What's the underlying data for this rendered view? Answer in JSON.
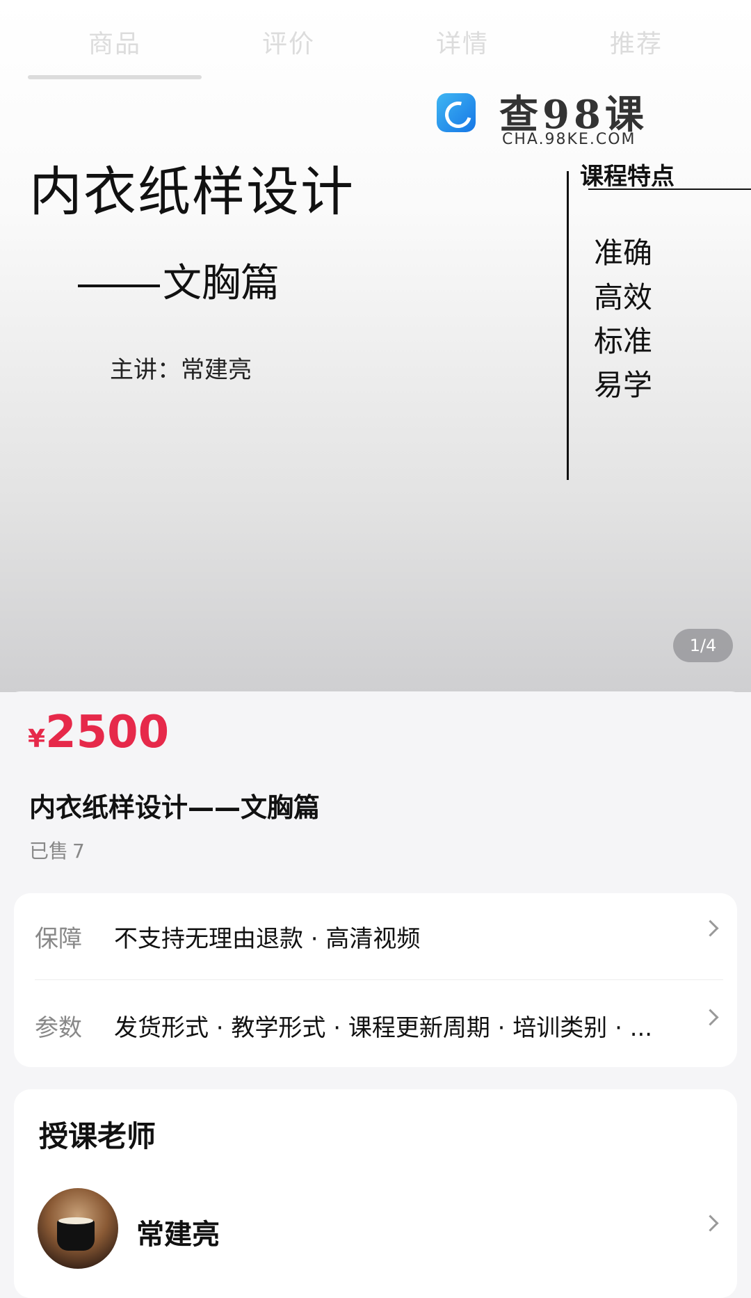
{
  "tabs": [
    "商品",
    "评价",
    "详情",
    "推荐"
  ],
  "watermark": {
    "name": "查98课",
    "url": "CHA.98KE.COM"
  },
  "slide": {
    "title": "内衣纸样设计",
    "subtitle": "文胸篇",
    "speaker": "主讲：常建亮",
    "features_title": "课程特点",
    "features": [
      "准确",
      "高效",
      "标准",
      "易学"
    ]
  },
  "gallery": {
    "counter": "1/4"
  },
  "product": {
    "currency": "¥",
    "price": "2500",
    "title": "内衣纸样设计——文胸篇",
    "sold_label": "已售",
    "sold_count": "7",
    "price_color": "#e6294a"
  },
  "info": {
    "guarantee": {
      "key": "保障",
      "value": "不支持无理由退款 · 高清视频"
    },
    "params": {
      "key": "参数",
      "value": "发货形式 · 教学形式 · 课程更新周期 · 培训类别 · ..."
    }
  },
  "teacher": {
    "heading": "授课老师",
    "name": "常建亮"
  }
}
